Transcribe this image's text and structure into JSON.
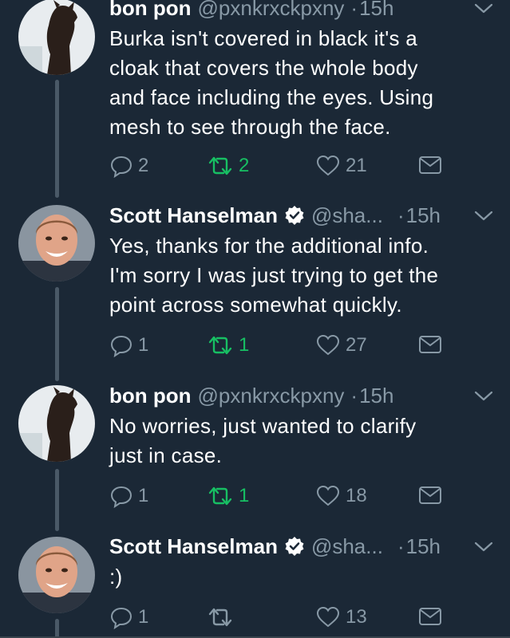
{
  "tweets": [
    {
      "name": "bon pon",
      "handle": "@pxnkrxckpxny",
      "separator": "·",
      "time": "15h",
      "verified": false,
      "lines": [
        "Burka isn't covered in black it's a",
        "cloak that covers the whole body",
        "and face including the eyes. Using",
        "mesh to see through the face."
      ],
      "replies": "2",
      "retweets": "2",
      "likes": "21",
      "retweeted": true
    },
    {
      "name": "Scott Hanselman",
      "handle": "@sha...",
      "separator": "·",
      "time": "15h",
      "verified": true,
      "lines": [
        "Yes, thanks for the additional info.",
        "I'm sorry I was just trying to get the",
        "point across somewhat quickly."
      ],
      "replies": "1",
      "retweets": "1",
      "likes": "27",
      "retweeted": true
    },
    {
      "name": "bon pon",
      "handle": "@pxnkrxckpxny",
      "separator": "·",
      "time": "15h",
      "verified": false,
      "lines": [
        "No worries, just wanted to clarify",
        "just in case."
      ],
      "replies": "1",
      "retweets": "1",
      "likes": "18",
      "retweeted": true
    },
    {
      "name": "Scott Hanselman",
      "handle": "@sha...",
      "separator": "·",
      "time": "15h",
      "verified": true,
      "lines": [
        ":)"
      ],
      "replies": "1",
      "retweets": "",
      "likes": "13",
      "retweeted": false
    }
  ],
  "icons": {
    "reply": "reply-icon",
    "retweet": "retweet-icon",
    "like": "heart-icon",
    "message": "envelope-icon",
    "more": "chevron-down-icon",
    "verified": "verified-badge-icon"
  },
  "colors": {
    "background": "#1b2836",
    "muted": "#8899a6",
    "retweet_green": "#17bf63",
    "verified_bg": "#ffffff"
  }
}
